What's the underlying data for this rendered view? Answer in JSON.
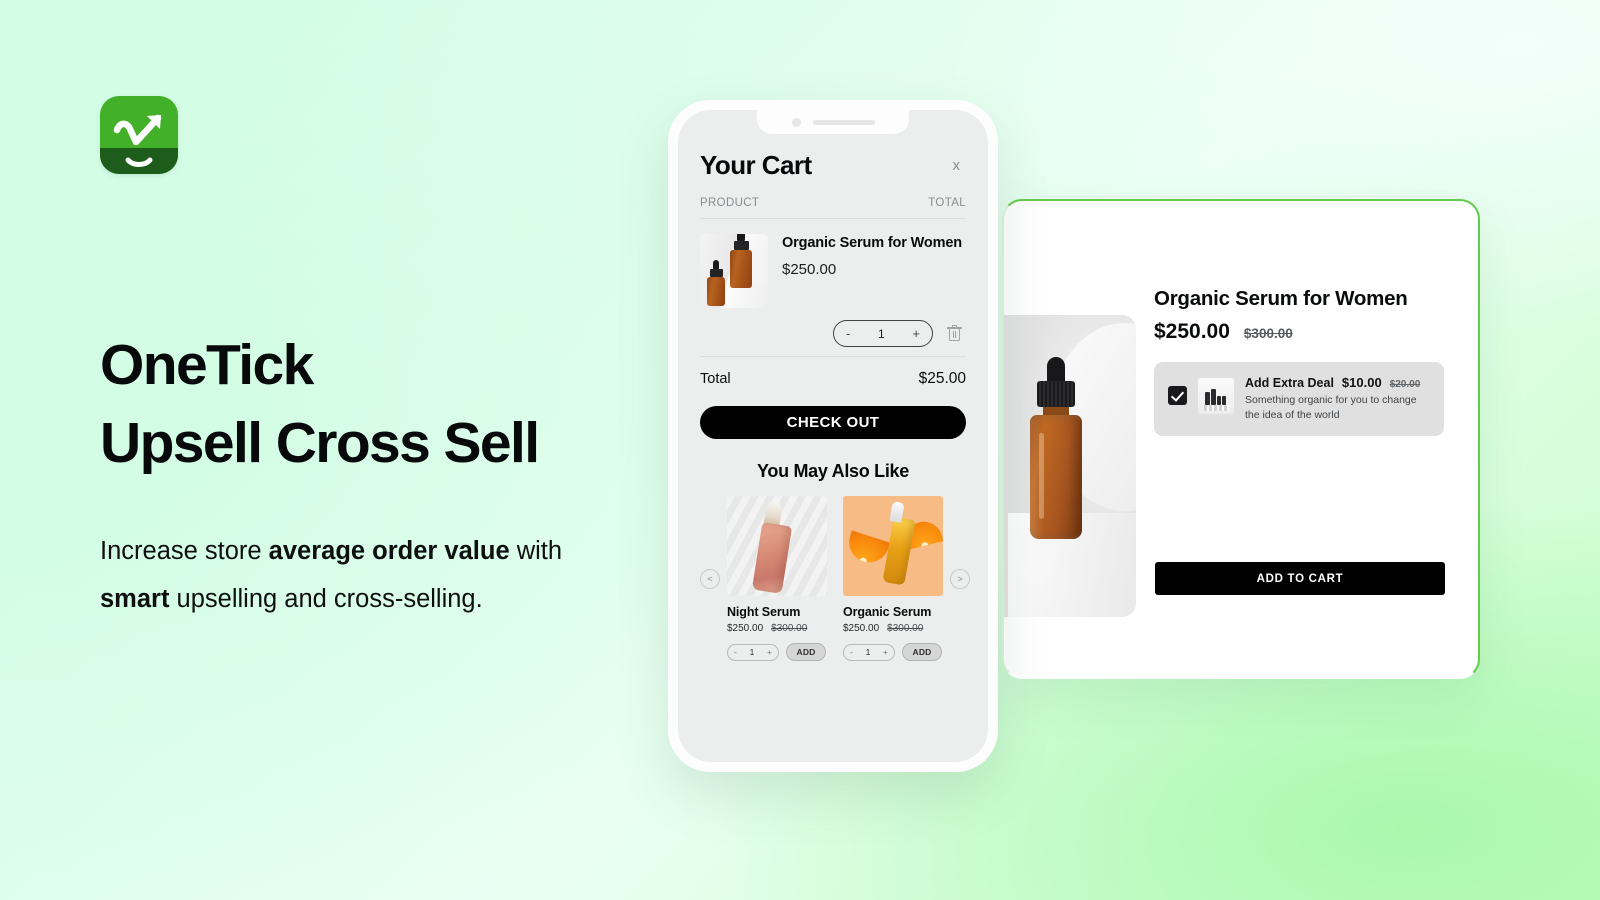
{
  "brand": {
    "logo_icon": "checkmark-growth-arrow-icon",
    "accent_green": "#43b02a",
    "accent_dark_green": "#1e5c1c",
    "panel_border_green": "#62cc4b"
  },
  "hero": {
    "title_line1": "OneTick",
    "title_line2": "Upsell Cross Sell",
    "subhead_part1": "Increase store ",
    "subhead_bold1": "average order value",
    "subhead_part2": " with ",
    "subhead_bold2": "smart",
    "subhead_part3": " upselling and cross-selling."
  },
  "phone": {
    "cart": {
      "title": "Your Cart",
      "close_label": "x",
      "col_product": "PRODUCT",
      "col_total": "TOTAL",
      "item": {
        "name": "Organic Serum for Women",
        "price": "$250.00",
        "quantity": "1",
        "decrement_label": "-",
        "increment_label": "+",
        "remove_icon": "trash-icon",
        "thumb_icon": "serum-bottles-image"
      },
      "total_label": "Total",
      "total_value": "$25.00",
      "checkout_label": "CHECK OUT"
    },
    "recommendations": {
      "title": "You May Also Like",
      "prev_label": "<",
      "next_label": ">",
      "items": [
        {
          "name": "Night Serum",
          "price": "$250.00",
          "compare_at": "$300.00",
          "quantity": "1",
          "decrement_label": "-",
          "increment_label": "+",
          "add_label": "ADD",
          "image_icon": "night-serum-bottle-image"
        },
        {
          "name": "Organic Serum",
          "price": "$250.00",
          "compare_at": "$300.00",
          "quantity": "1",
          "decrement_label": "-",
          "increment_label": "+",
          "add_label": "ADD",
          "image_icon": "organic-serum-orange-image"
        }
      ]
    }
  },
  "detail_panel": {
    "product_image_icon": "amber-dropper-bottle-image",
    "title": "Organic Serum for Women",
    "price": "$250.00",
    "compare_at": "$300.00",
    "deal": {
      "checked": true,
      "thumb_icon": "deal-product-image",
      "name": "Add Extra Deal",
      "price": "$10.00",
      "compare_at": "$20.00",
      "description": "Something organic for you to change the idea of the world"
    },
    "add_to_cart_label": "ADD TO CART"
  }
}
